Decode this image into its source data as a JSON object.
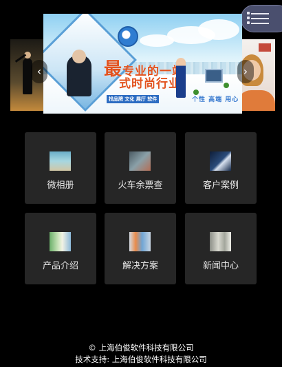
{
  "menu": {
    "icon": "menu-icon"
  },
  "banner": {
    "headline_big": "最",
    "headline_line1": "专业的一站",
    "headline_line2": "式时尚行业",
    "tag": "找品牌 文化 展厅 软件",
    "subline": "个性 高端 用心",
    "prev_icon": "chevron-left-icon",
    "next_icon": "chevron-right-icon",
    "prev_glyph": "‹",
    "next_glyph": "›"
  },
  "tiles": [
    {
      "label": "微相册"
    },
    {
      "label": "火车余票查"
    },
    {
      "label": "客户案例"
    },
    {
      "label": "产品介绍"
    },
    {
      "label": "解决方案"
    },
    {
      "label": "新闻中心"
    }
  ],
  "footer": {
    "copyright": "© 上海伯俊软件科技有限公司",
    "support": "技术支持: 上海伯俊软件科技有限公司"
  }
}
